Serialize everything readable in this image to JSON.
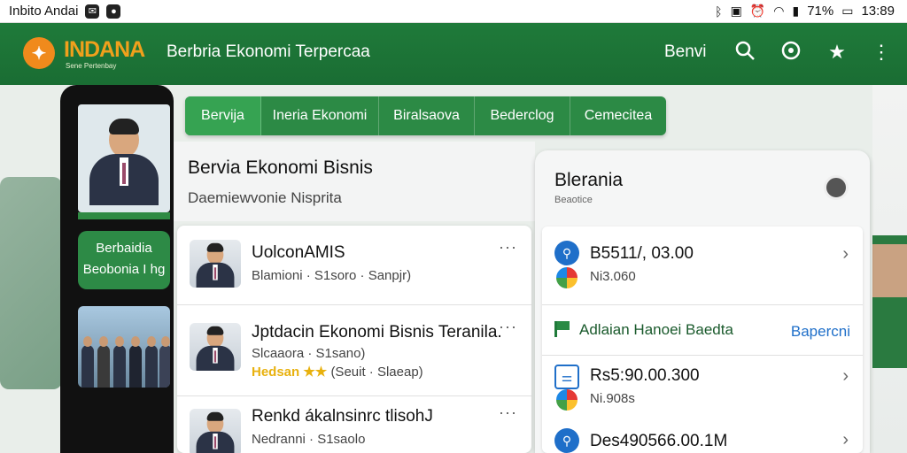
{
  "status_bar": {
    "carrier": "Inbito Andai",
    "time": "13:89",
    "battery": "71%",
    "icons": [
      "wifi-icon",
      "signal-icon",
      "alarm-icon",
      "battery-icon"
    ]
  },
  "app_bar": {
    "logo_text": "INDANA",
    "logo_sub": "Sene Pertenbay",
    "title": "Berbria Ekonomi Terpercaa",
    "user": "Benvi",
    "icons": [
      "search-icon",
      "settings-icon",
      "star-icon",
      "more-icon"
    ],
    "brand_color": "#1f7a3a",
    "accent_color": "#f08a1c"
  },
  "tabs": [
    {
      "label": "Bervija",
      "active": true
    },
    {
      "label": "Ineria Ekonomi",
      "active": false
    },
    {
      "label": "Biralsaova",
      "active": false
    },
    {
      "label": "Bederclog",
      "active": false
    },
    {
      "label": "Cemecitea",
      "active": false
    }
  ],
  "side_phone": {
    "button_label_1": "Berbaidia",
    "button_label_2": "Beobonia I hg"
  },
  "main": {
    "title": "Bervia Ekonomi Bisnis",
    "subtitle": "Daemiewvonie Nisprita",
    "items": [
      {
        "title": "UolconAMIS",
        "subtitle": "Blamioni · S1soro · Sanpjr)",
        "more": "···"
      },
      {
        "title": "Jptdacin Ekonomi Bisnis Teranila.",
        "subtitle": "Slcaaora · S1sano)",
        "rating_text": "Hedsan",
        "stars": "★★",
        "rating_tail": "(Seuit · Slaeap)",
        "more": "···"
      },
      {
        "title": "Renkd ákalnsinrc tlisohJ",
        "subtitle": "Nedranni · S1saolo",
        "more": "···"
      }
    ]
  },
  "right_panel": {
    "title": "Blerania",
    "subtitle": "Beaotice",
    "transactions": [
      {
        "amount": "B5511/, 03.00",
        "sub": "Ni3.060",
        "icon": "bicycle-icon"
      },
      {
        "amount": "Rs5:90.00.300",
        "sub": "Ni.908s",
        "icon": "receipt-icon"
      },
      {
        "amount": "Des490566.00.1M",
        "sub": "",
        "icon": "bicycle-icon"
      }
    ],
    "section": {
      "label": "Adlaian Hanoei Baedta",
      "link": "Bapercni"
    }
  }
}
